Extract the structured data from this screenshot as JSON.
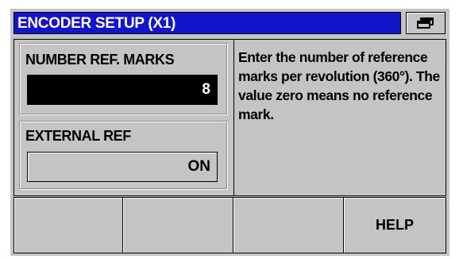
{
  "window": {
    "title": "ENCODER SETUP (X1)",
    "title_button_icon": "window-switch-icon"
  },
  "fields": [
    {
      "label": "NUMBER REF. MARKS",
      "value": "8",
      "state": "selected"
    },
    {
      "label": "EXTERNAL REF",
      "value": "ON",
      "state": "normal"
    }
  ],
  "help_text": "Enter the number of reference marks per revolution (360°). The value zero means no reference mark.",
  "softkeys": [
    "",
    "",
    "",
    "HELP"
  ],
  "colors": {
    "title_bar": "#1414cc",
    "background": "#c4c4c4",
    "selected_field": "#000000"
  }
}
